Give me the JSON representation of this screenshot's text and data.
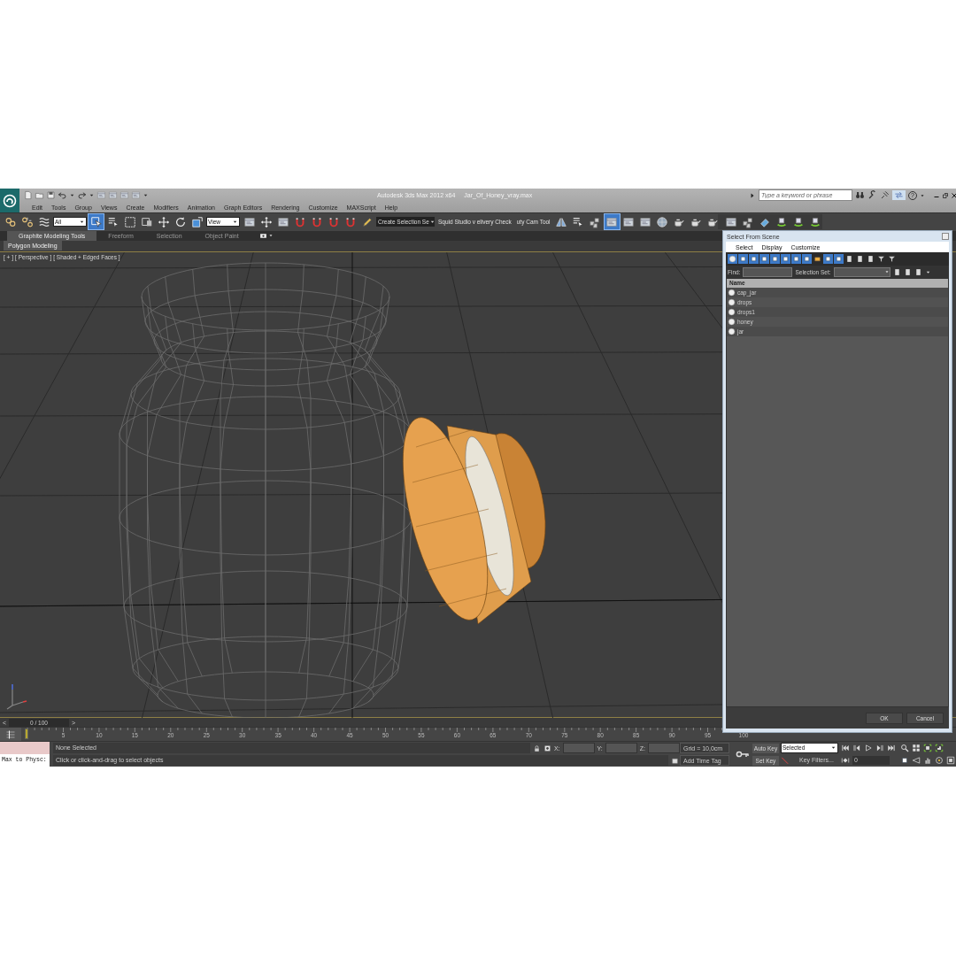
{
  "title_bar": {
    "app_title": "Autodesk 3ds Max  2012 x64",
    "file_name": "Jar_Of_Honey_vray.max",
    "search": {
      "placeholder": "Type a keyword or phrase"
    },
    "help": "?"
  },
  "menu": [
    "Edit",
    "Tools",
    "Group",
    "Views",
    "Create",
    "Modifiers",
    "Animation",
    "Graph Editors",
    "Rendering",
    "Customize",
    "MAXScript",
    "Help"
  ],
  "main_toolbar": [
    {
      "kind": "button",
      "selected": false
    },
    {
      "kind": "button",
      "selected": false
    },
    {
      "kind": "button",
      "selected": false
    },
    {
      "kind": "dropdown",
      "value": "All"
    },
    {
      "kind": "button",
      "selected": true
    },
    {
      "kind": "button",
      "selected": false
    },
    {
      "kind": "button",
      "selected": false
    },
    {
      "kind": "button",
      "selected": false
    },
    {
      "kind": "button",
      "selected": false
    },
    {
      "kind": "button",
      "selected": false
    },
    {
      "kind": "button",
      "selected": false
    },
    {
      "kind": "dropdown",
      "value": "View"
    },
    {
      "kind": "button",
      "selected": false
    },
    {
      "kind": "button",
      "selected": false
    },
    {
      "kind": "button",
      "selected": false
    },
    {
      "kind": "button",
      "selected": false
    },
    {
      "kind": "button",
      "selected": false
    },
    {
      "kind": "button",
      "selected": false
    },
    {
      "kind": "button",
      "selected": false
    },
    {
      "kind": "button",
      "selected": false
    },
    {
      "kind": "dropdown",
      "value": "Create Selection Se"
    },
    {
      "kind": "script",
      "text": "Squid Studio v elivery Check"
    },
    {
      "kind": "script",
      "text": "uty Cam Tool"
    },
    {
      "kind": "button",
      "selected": false
    },
    {
      "kind": "button",
      "selected": false
    },
    {
      "kind": "button",
      "selected": false
    },
    {
      "kind": "button",
      "selected": true
    },
    {
      "kind": "button",
      "selected": false
    },
    {
      "kind": "button",
      "selected": false
    },
    {
      "kind": "button",
      "selected": false
    },
    {
      "kind": "button",
      "selected": false
    },
    {
      "kind": "button",
      "selected": false
    },
    {
      "kind": "button",
      "selected": false
    }
  ],
  "extra_toolbar": [
    {
      "selected": false
    },
    {
      "selected": false
    },
    {
      "selected": false
    },
    {
      "selected": false
    },
    {
      "selected": false
    },
    {
      "selected": false
    }
  ],
  "ribbon": {
    "tabs": [
      {
        "label": "Graphite Modeling Tools",
        "selected": true
      },
      {
        "label": "Freeform",
        "selected": false
      },
      {
        "label": "Selection",
        "selected": false
      },
      {
        "label": "Object Paint",
        "selected": false
      }
    ],
    "panel": "Polygon Modeling"
  },
  "viewport": {
    "labels": [
      "[ + ]",
      "[ Perspective ]",
      "[ Shaded + Edged Faces ]"
    ],
    "active": true
  },
  "select_from_scene": {
    "title": "Select From Scene",
    "menu": [
      "Select",
      "Display",
      "Customize"
    ],
    "toolbar": [
      {
        "selected": true
      },
      {
        "selected": true
      },
      {
        "selected": true
      },
      {
        "selected": true
      },
      {
        "selected": true
      },
      {
        "selected": true
      },
      {
        "selected": true
      },
      {
        "selected": true
      },
      {
        "selected": false
      },
      {
        "selected": true
      },
      {
        "selected": true
      },
      {
        "selected": false
      },
      {
        "selected": false
      },
      {
        "selected": false
      },
      {
        "selected": false
      },
      {
        "selected": false
      }
    ],
    "find_label": "Find:",
    "selection_set_label": "Selection Set:",
    "column": "Name",
    "objects": [
      {
        "name": "cap_jar",
        "selected": false
      },
      {
        "name": "drops",
        "selected": false
      },
      {
        "name": "drops1",
        "selected": false
      },
      {
        "name": "honey",
        "selected": false
      },
      {
        "name": "jar",
        "selected": false
      }
    ],
    "buttons": [
      "OK",
      "Cancel"
    ]
  },
  "time_slider": {
    "prev": "<",
    "position": "0 / 100",
    "next": ">",
    "level": 0
  },
  "track_bar": {
    "labels": [
      "5",
      "10",
      "15",
      "20",
      "25",
      "30",
      "35",
      "40",
      "45",
      "50",
      "55",
      "60",
      "65",
      "70",
      "75",
      "80",
      "85",
      "90",
      "95",
      "100"
    ]
  },
  "status": {
    "listener": "Max to Physc:",
    "selection": "None Selected",
    "prompt": "Click or click-and-drag to select objects",
    "x_label": "X:",
    "y_label": "Y:",
    "z_label": "Z:",
    "grid": "Grid = 10,0cm",
    "time_tag": "Add Time Tag",
    "auto_key": "Auto Key",
    "key_mode": "Selected",
    "set_key": "Set Key",
    "key_filters": "Key Filters...",
    "frame": "0"
  }
}
